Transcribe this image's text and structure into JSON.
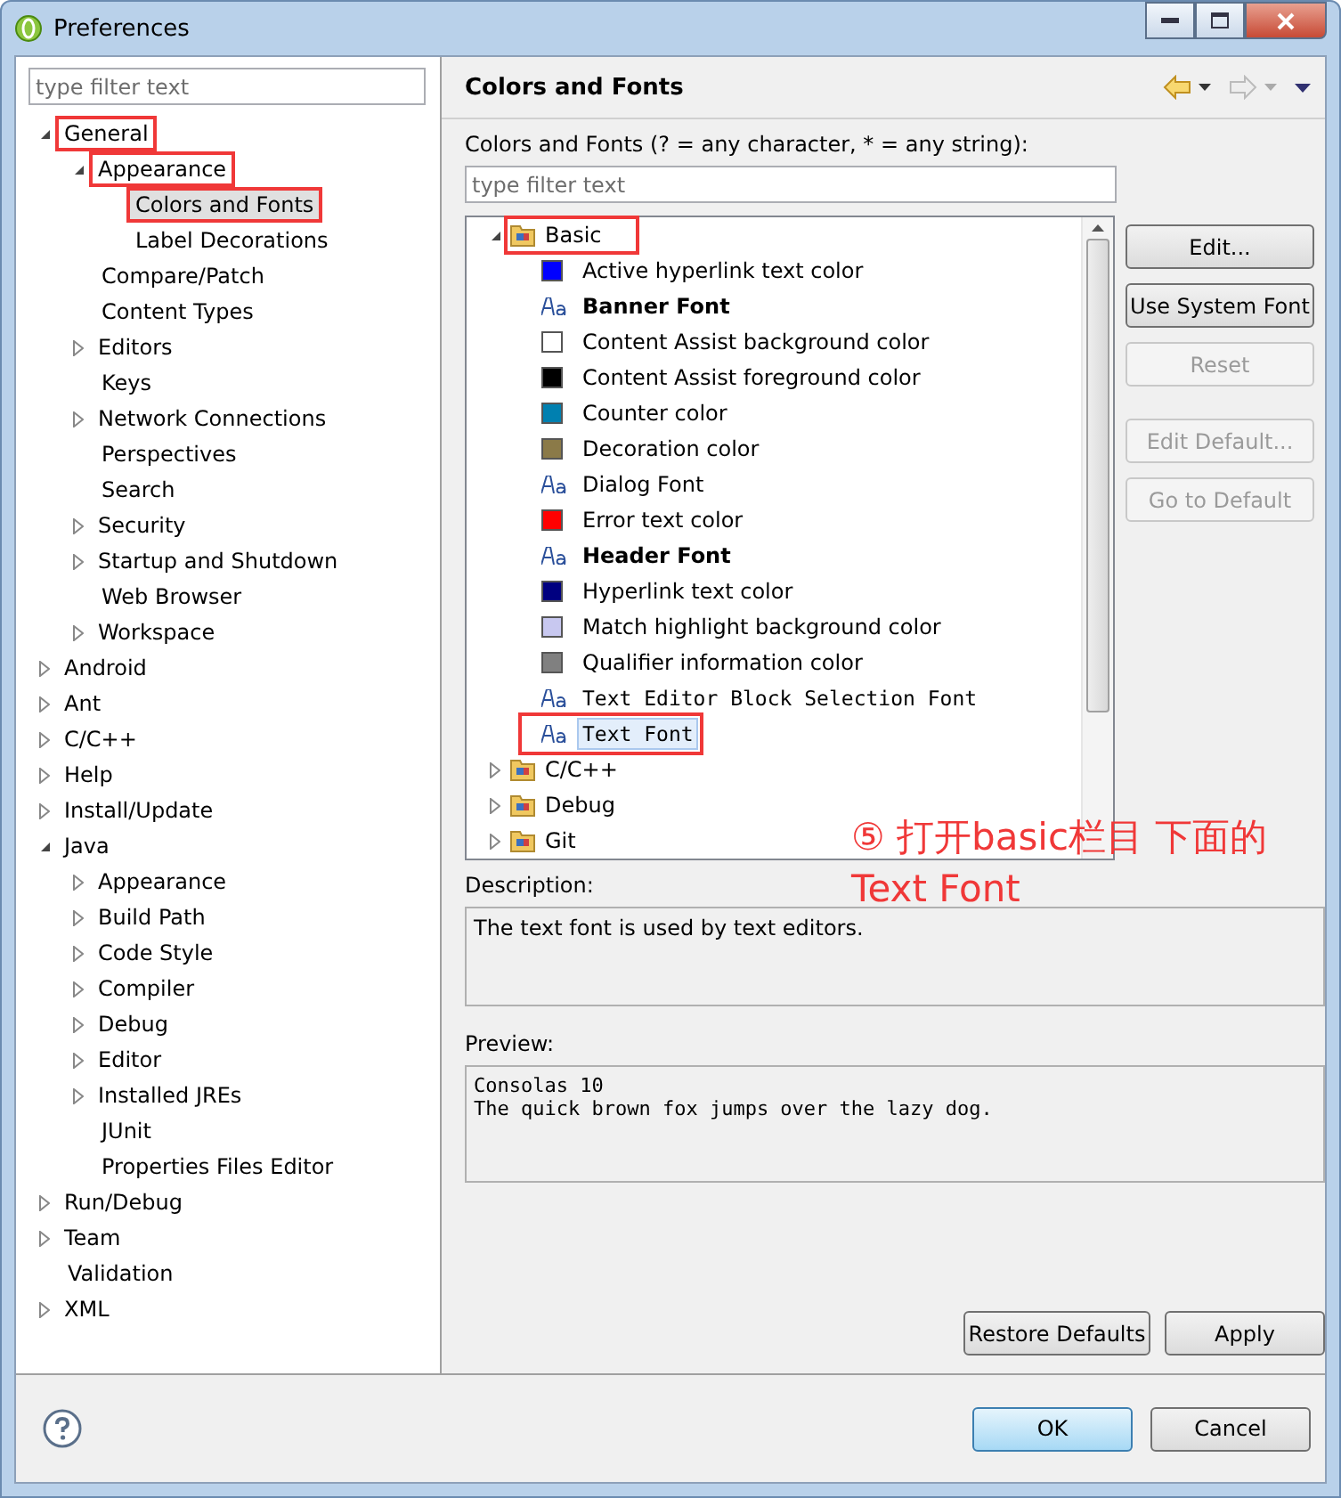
{
  "window": {
    "title": "Preferences"
  },
  "sidebar": {
    "filter": {
      "placeholder": "type filter text"
    },
    "items": [
      {
        "label": "General",
        "kind": "branch",
        "expanded": true,
        "selected": false,
        "marked": true,
        "children": [
          {
            "label": "Appearance",
            "kind": "branch",
            "expanded": true,
            "selected": false,
            "marked": true,
            "children": [
              {
                "label": "Colors and Fonts",
                "kind": "leaf",
                "selected": true,
                "marked": true
              },
              {
                "label": "Label Decorations",
                "kind": "leaf",
                "selected": false,
                "marked": false
              }
            ]
          },
          {
            "label": "Compare/Patch",
            "kind": "leaf",
            "selected": false,
            "marked": false
          },
          {
            "label": "Content Types",
            "kind": "leaf",
            "selected": false,
            "marked": false
          },
          {
            "label": "Editors",
            "kind": "branch",
            "expanded": false,
            "selected": false,
            "marked": false
          },
          {
            "label": "Keys",
            "kind": "leaf",
            "selected": false,
            "marked": false
          },
          {
            "label": "Network Connections",
            "kind": "branch",
            "expanded": false,
            "selected": false,
            "marked": false
          },
          {
            "label": "Perspectives",
            "kind": "leaf",
            "selected": false,
            "marked": false
          },
          {
            "label": "Search",
            "kind": "leaf",
            "selected": false,
            "marked": false
          },
          {
            "label": "Security",
            "kind": "branch",
            "expanded": false,
            "selected": false,
            "marked": false
          },
          {
            "label": "Startup and Shutdown",
            "kind": "branch",
            "expanded": false,
            "selected": false,
            "marked": false
          },
          {
            "label": "Web Browser",
            "kind": "leaf",
            "selected": false,
            "marked": false
          },
          {
            "label": "Workspace",
            "kind": "branch",
            "expanded": false,
            "selected": false,
            "marked": false
          }
        ]
      },
      {
        "label": "Android",
        "kind": "branch",
        "expanded": false,
        "selected": false,
        "marked": false
      },
      {
        "label": "Ant",
        "kind": "branch",
        "expanded": false,
        "selected": false,
        "marked": false
      },
      {
        "label": "C/C++",
        "kind": "branch",
        "expanded": false,
        "selected": false,
        "marked": false
      },
      {
        "label": "Help",
        "kind": "branch",
        "expanded": false,
        "selected": false,
        "marked": false
      },
      {
        "label": "Install/Update",
        "kind": "branch",
        "expanded": false,
        "selected": false,
        "marked": false
      },
      {
        "label": "Java",
        "kind": "branch",
        "expanded": true,
        "selected": false,
        "marked": false,
        "children": [
          {
            "label": "Appearance",
            "kind": "branch",
            "expanded": false,
            "selected": false,
            "marked": false
          },
          {
            "label": "Build Path",
            "kind": "branch",
            "expanded": false,
            "selected": false,
            "marked": false
          },
          {
            "label": "Code Style",
            "kind": "branch",
            "expanded": false,
            "selected": false,
            "marked": false
          },
          {
            "label": "Compiler",
            "kind": "branch",
            "expanded": false,
            "selected": false,
            "marked": false
          },
          {
            "label": "Debug",
            "kind": "branch",
            "expanded": false,
            "selected": false,
            "marked": false
          },
          {
            "label": "Editor",
            "kind": "branch",
            "expanded": false,
            "selected": false,
            "marked": false
          },
          {
            "label": "Installed JREs",
            "kind": "branch",
            "expanded": false,
            "selected": false,
            "marked": false
          },
          {
            "label": "JUnit",
            "kind": "leaf",
            "selected": false,
            "marked": false
          },
          {
            "label": "Properties Files Editor",
            "kind": "leaf",
            "selected": false,
            "marked": false
          }
        ]
      },
      {
        "label": "Run/Debug",
        "kind": "branch",
        "expanded": false,
        "selected": false,
        "marked": false
      },
      {
        "label": "Team",
        "kind": "branch",
        "expanded": false,
        "selected": false,
        "marked": false
      },
      {
        "label": "Validation",
        "kind": "leaf",
        "selected": false,
        "marked": false
      },
      {
        "label": "XML",
        "kind": "branch",
        "expanded": false,
        "selected": false,
        "marked": false
      }
    ]
  },
  "page": {
    "title": "Colors and Fonts",
    "filter_label": "Colors and Fonts (? = any character, * = any string):",
    "filter": {
      "placeholder": "type filter text"
    },
    "categories": [
      {
        "label": "Basic",
        "expanded": true,
        "marked": true,
        "items": [
          {
            "label": "Active hyperlink text color",
            "kind": "color",
            "color": "#0000ff",
            "selected": false,
            "marked": false
          },
          {
            "label": "Banner Font",
            "kind": "boldfont",
            "selected": false,
            "marked": false
          },
          {
            "label": "Content Assist background color",
            "kind": "color",
            "color": "#ffffff",
            "selected": false,
            "marked": false
          },
          {
            "label": "Content Assist foreground color",
            "kind": "color",
            "color": "#000000",
            "selected": false,
            "marked": false
          },
          {
            "label": "Counter color",
            "kind": "color",
            "color": "#0080b0",
            "selected": false,
            "marked": false
          },
          {
            "label": "Decoration color",
            "kind": "color",
            "color": "#8b7a48",
            "selected": false,
            "marked": false
          },
          {
            "label": "Dialog Font",
            "kind": "font",
            "selected": false,
            "marked": false
          },
          {
            "label": "Error text color",
            "kind": "color",
            "color": "#ff0000",
            "selected": false,
            "marked": false
          },
          {
            "label": "Header Font",
            "kind": "boldfont",
            "selected": false,
            "marked": false
          },
          {
            "label": "Hyperlink text color",
            "kind": "color",
            "color": "#000080",
            "selected": false,
            "marked": false
          },
          {
            "label": "Match highlight background color",
            "kind": "color",
            "color": "#c8c8f0",
            "selected": false,
            "marked": false
          },
          {
            "label": "Qualifier information color",
            "kind": "color",
            "color": "#808080",
            "selected": false,
            "marked": false
          },
          {
            "label": "Text Editor Block Selection Font",
            "kind": "monofont",
            "selected": false,
            "marked": false
          },
          {
            "label": "Text Font",
            "kind": "monofont",
            "selected": true,
            "marked": true
          }
        ]
      },
      {
        "label": "C/C++",
        "expanded": false,
        "marked": false
      },
      {
        "label": "Debug",
        "expanded": false,
        "marked": false
      },
      {
        "label": "Git",
        "expanded": false,
        "marked": false
      }
    ],
    "side_buttons": [
      {
        "label": "Edit...",
        "disabled": false
      },
      {
        "label": "Use System Font",
        "disabled": false
      },
      {
        "label": "Reset",
        "disabled": true
      },
      {
        "label": "Edit Default...",
        "disabled": true
      },
      {
        "label": "Go to Default",
        "disabled": true
      }
    ],
    "description": {
      "label": "Description:",
      "text": "The text font is used by text editors."
    },
    "preview": {
      "label": "Preview:",
      "lines": [
        "Consolas 10",
        "The quick brown fox jumps over the lazy dog."
      ]
    },
    "buttons": [
      "Restore Defaults",
      "Apply"
    ]
  },
  "annotation": {
    "lines": [
      "⑤ 打开basic栏目 下面的",
      "Text Font"
    ]
  },
  "footer": {
    "buttons": [
      {
        "label": "OK",
        "default": true
      },
      {
        "label": "Cancel",
        "default": false
      }
    ]
  }
}
